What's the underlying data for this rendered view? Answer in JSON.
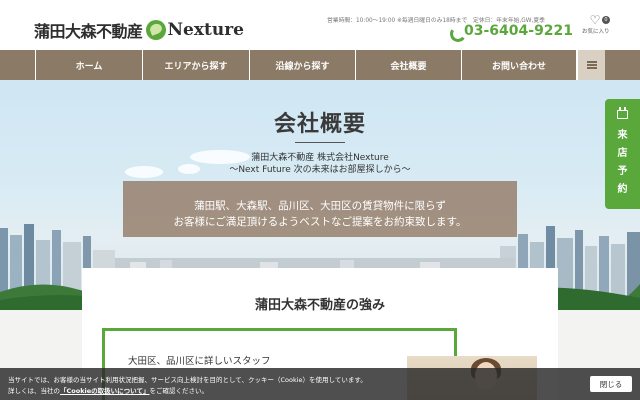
{
  "header": {
    "logo_jp": "蒲田大森不動産",
    "logo_en": "Nexture",
    "hours": "営業時間：10:00～19:00 ※毎週日曜日のみ18時まで　定休日：年末年始,GW,夏季",
    "phone": "03-6404-9221",
    "favorites_label": "お気に入り",
    "favorites_count": "0"
  },
  "nav": {
    "items": [
      {
        "label": "ホーム"
      },
      {
        "label": "エリアから探す"
      },
      {
        "label": "沿線から探す"
      },
      {
        "label": "会社概要"
      },
      {
        "label": "お問い合わせ"
      }
    ]
  },
  "hero": {
    "title": "会社概要",
    "sub1": "蒲田大森不動産 株式会社Nexture",
    "sub2": "～Next Future 次の未来はお部屋探しから～",
    "box_line1": "蒲田駅、大森駅、品川区、大田区の賃貸物件に限らず",
    "box_line2": "お客様にご満足頂けるようベストなご提案をお約束致します。"
  },
  "reserve": {
    "label": "来店予約"
  },
  "content": {
    "strength_title": "蒲田大森不動産の強み",
    "box_label": "大田区、品川区に詳しいスタッフ"
  },
  "cookie": {
    "line1": "当サイトでは、お客様の当サイト利用状況把握、サービス向上検討を目的として、クッキー（Cookie）を使用しています。",
    "line2_pre": "詳しくは、当社の",
    "link": "「Cookieの取扱いについて」",
    "line2_post": "をご確認ください。",
    "close_label": "閉じる"
  }
}
